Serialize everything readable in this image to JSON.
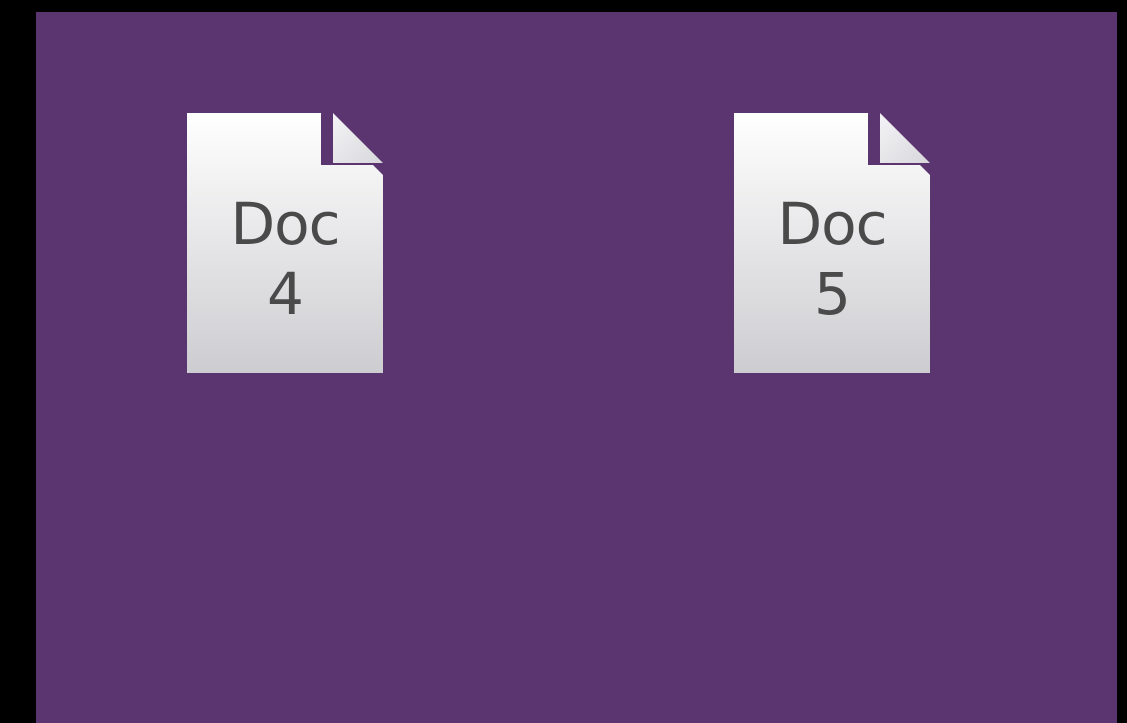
{
  "colors": {
    "background": "#000000",
    "panel": "#5b3570",
    "doc_top": "#ffffff",
    "doc_bottom": "#cfcfd2",
    "doc_text": "#4a4a4a"
  },
  "documents": [
    {
      "icon": "document-icon",
      "line1": "Doc",
      "line2": "4"
    },
    {
      "icon": "document-icon",
      "line1": "Doc",
      "line2": "5"
    }
  ]
}
